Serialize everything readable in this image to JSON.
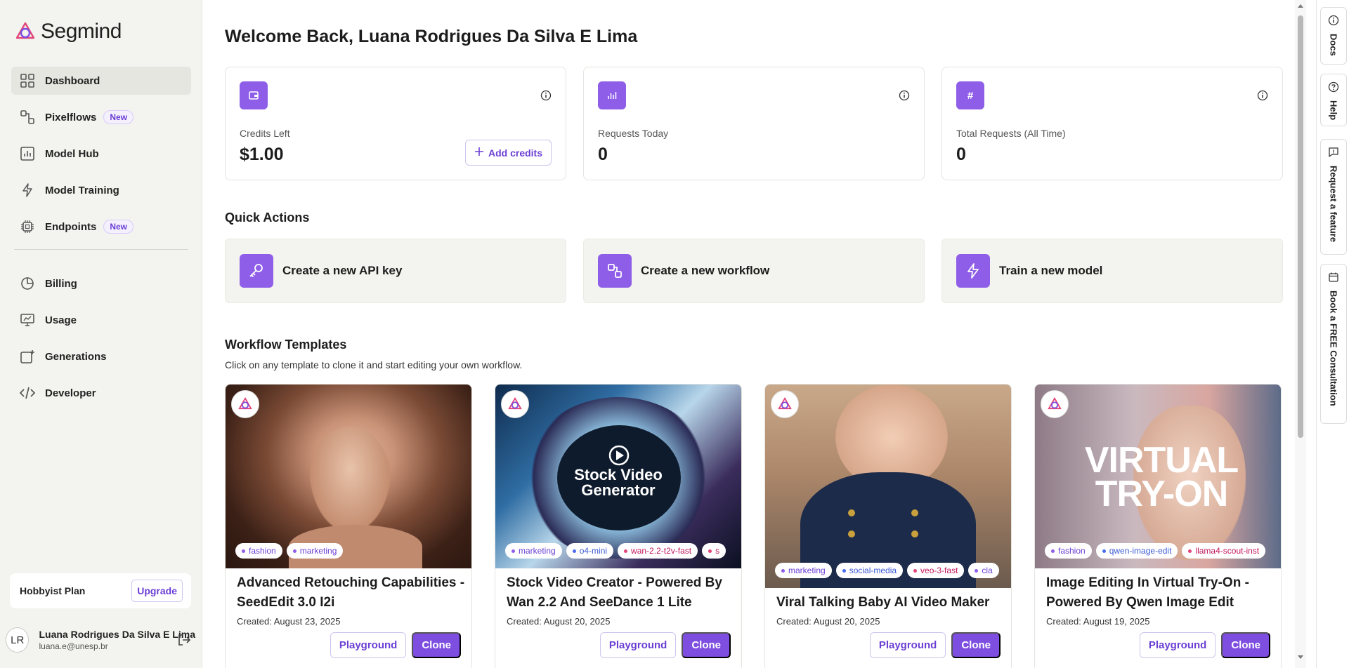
{
  "app": {
    "name": "Segmind"
  },
  "nav": {
    "items": [
      {
        "label": "Dashboard",
        "badge": ""
      },
      {
        "label": "Pixelflows",
        "badge": "New"
      },
      {
        "label": "Model Hub",
        "badge": ""
      },
      {
        "label": "Model Training",
        "badge": ""
      },
      {
        "label": "Endpoints",
        "badge": "New"
      },
      {
        "label": "Billing",
        "badge": ""
      },
      {
        "label": "Usage",
        "badge": ""
      },
      {
        "label": "Generations",
        "badge": ""
      },
      {
        "label": "Developer",
        "badge": ""
      }
    ]
  },
  "plan": {
    "label": "Hobbyist Plan",
    "upgrade": "Upgrade"
  },
  "user": {
    "initials": "LR",
    "name": "Luana Rodrigues Da Silva E Lima",
    "email": "luana.e@unesp.br"
  },
  "header": {
    "welcome": "Welcome Back, Luana Rodrigues Da Silva E Lima"
  },
  "stats": [
    {
      "label": "Credits Left",
      "value": "$1.00",
      "icon": "wallet-icon"
    },
    {
      "label": "Requests Today",
      "value": "0",
      "icon": "bar-chart-icon"
    },
    {
      "label": "Total Requests (All Time)",
      "value": "0",
      "icon": "hash-icon"
    }
  ],
  "add_credits": "Add credits",
  "quick_actions": {
    "title": "Quick Actions",
    "items": [
      {
        "label": "Create a new API key",
        "icon": "key-icon"
      },
      {
        "label": "Create a new workflow",
        "icon": "workflow-icon"
      },
      {
        "label": "Train a new model",
        "icon": "lightning-icon"
      }
    ]
  },
  "templates": {
    "title": "Workflow Templates",
    "subtitle": "Click on any template to clone it and start editing your own workflow.",
    "play_label": "Playground",
    "clone_label": "Clone",
    "items": [
      {
        "title": "Advanced Retouching Capabilities - SeedEdit 3.0 I2i",
        "date": "Created: August 23, 2025",
        "tags": [
          "fashion",
          "marketing"
        ]
      },
      {
        "title": "Stock Video Creator - Powered By Wan 2.2 And SeeDance 1 Lite",
        "date": "Created: August 20, 2025",
        "tags": [
          "marketing",
          "o4-mini",
          "wan-2.2-t2v-fast",
          "s"
        ],
        "image_text": "Stock Video Generator"
      },
      {
        "title": "Viral Talking Baby AI Video Maker",
        "date": "Created: August 20, 2025",
        "tags": [
          "marketing",
          "social-media",
          "veo-3-fast",
          "cla"
        ]
      },
      {
        "title": "Image Editing In Virtual Try-On - Powered By Qwen Image Edit",
        "date": "Created: August 19, 2025",
        "tags": [
          "fashion",
          "qwen-image-edit",
          "llama4-scout-inst"
        ],
        "image_text": "VIRTUAL TRY-ON"
      }
    ]
  },
  "rail": {
    "docs": "Docs",
    "help": "Help",
    "feature": "Request a feature",
    "consult": "Book a FREE Consultation"
  },
  "colors": {
    "accent": "#8f5ee8",
    "accent_dark": "#7d4ee0",
    "sidebar_bg": "#f3f3ef"
  }
}
